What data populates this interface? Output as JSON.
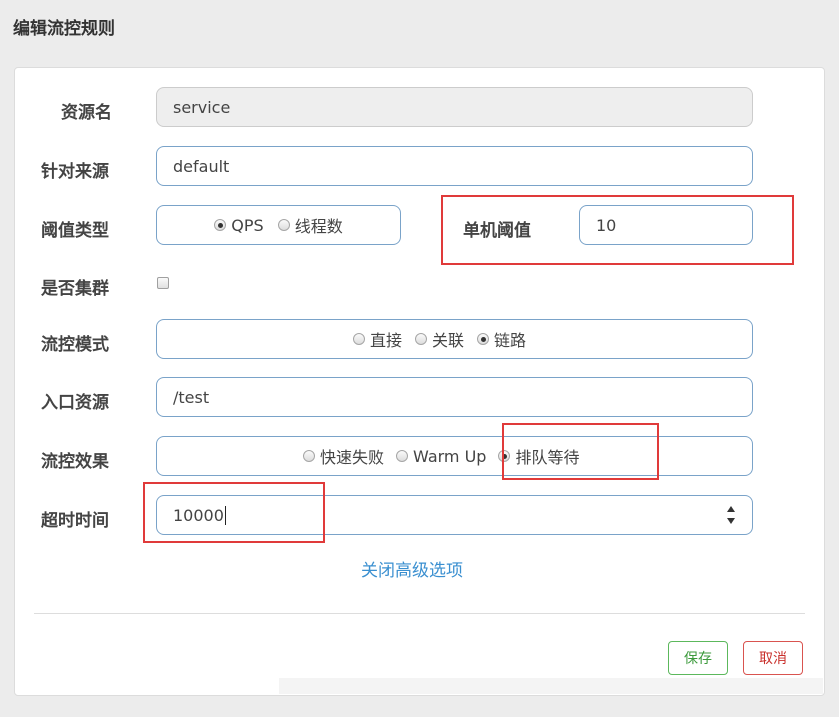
{
  "dialog": {
    "title": "编辑流控规则"
  },
  "form": {
    "resource": {
      "label": "资源名",
      "value": "service"
    },
    "limit_app": {
      "label": "针对来源",
      "value": "default"
    },
    "threshold_type": {
      "label": "阈值类型",
      "options": [
        "QPS",
        "线程数"
      ],
      "selected": "QPS"
    },
    "single_threshold": {
      "label": "单机阈值",
      "value": "10"
    },
    "cluster": {
      "label": "是否集群",
      "checked": false
    },
    "strategy": {
      "label": "流控模式",
      "options": [
        "直接",
        "关联",
        "链路"
      ],
      "selected": "链路"
    },
    "entry_resource": {
      "label": "入口资源",
      "value": "/test"
    },
    "control_behavior": {
      "label": "流控效果",
      "options": [
        "快速失败",
        "Warm Up",
        "排队等待"
      ],
      "selected": "排队等待"
    },
    "timeout": {
      "label": "超时时间",
      "value": "10000"
    },
    "toggle_advanced": "关闭高级选项"
  },
  "footer": {
    "save_label": "保存",
    "cancel_label": "取消"
  },
  "colors": {
    "highlight": "#e03a3a",
    "field_border": "#7aa3c9",
    "link": "#3a8fd0",
    "save": "#5cb85c",
    "cancel": "#d9534f"
  }
}
